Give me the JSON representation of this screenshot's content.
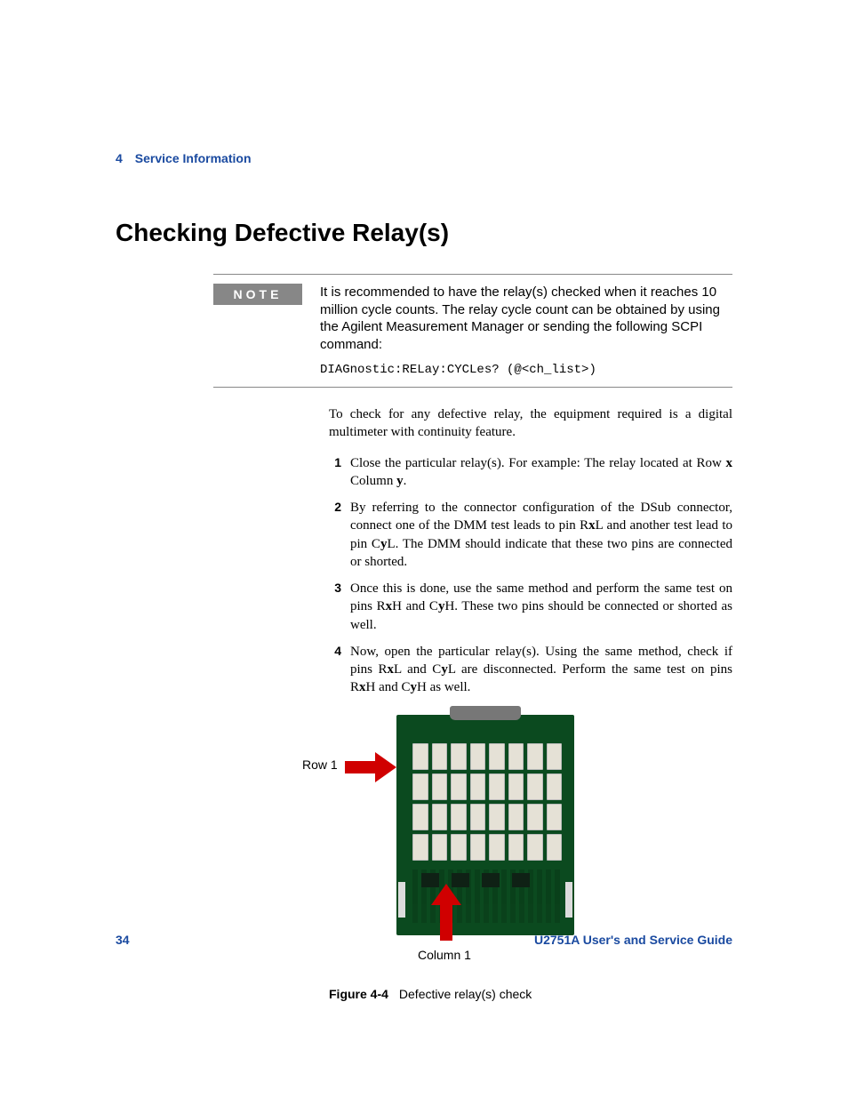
{
  "chapter": {
    "number": "4",
    "title": "Service Information"
  },
  "section_title": "Checking Defective Relay(s)",
  "note": {
    "label": "NOTE",
    "text": "It is recommended to have the relay(s) checked when it reaches 10 million cycle counts. The relay cycle count can be obtained by using the Agilent Measurement Manager or sending the following SCPI command:",
    "code": "DIAGnostic:RELay:CYCLes? (@<ch_list>)"
  },
  "intro": "To check for any defective relay, the equipment required is a digital multimeter with continuity feature.",
  "steps": [
    {
      "n": "1",
      "pre": "Close the particular relay(s). For example: The relay located at Row ",
      "b1": "x",
      "mid1": " Column ",
      "b2": "y",
      "post": "."
    },
    {
      "n": "2",
      "pre": "By referring to the connector configuration of the DSub connector, connect one of the DMM test leads to pin R",
      "b1": "x",
      "mid1": "L and another test lead to pin C",
      "b2": "y",
      "post": "L. The DMM should indicate that these two pins are connected or shorted."
    },
    {
      "n": "3",
      "pre": "Once this is done, use the same method and perform the same test on pins R",
      "b1": "x",
      "mid1": "H and C",
      "b2": "y",
      "post": "H. These two pins should be connected or shorted as well."
    },
    {
      "n": "4",
      "pre": "Now, open the particular relay(s). Using the same method, check if pins R",
      "b1": "x",
      "mid1": "L and C",
      "b2": "y",
      "post": "L are disconnected. Perform the same test on pins R",
      "b3": "x",
      "mid2": "H and C",
      "b4": "y",
      "post2": "H as well."
    }
  ],
  "figure": {
    "row_label": "Row 1",
    "col_label": "Column 1",
    "caption_name": "Figure 4-4",
    "caption_text": "Defective relay(s) check"
  },
  "footer": {
    "page": "34",
    "guide": "U2751A User's and Service Guide"
  }
}
